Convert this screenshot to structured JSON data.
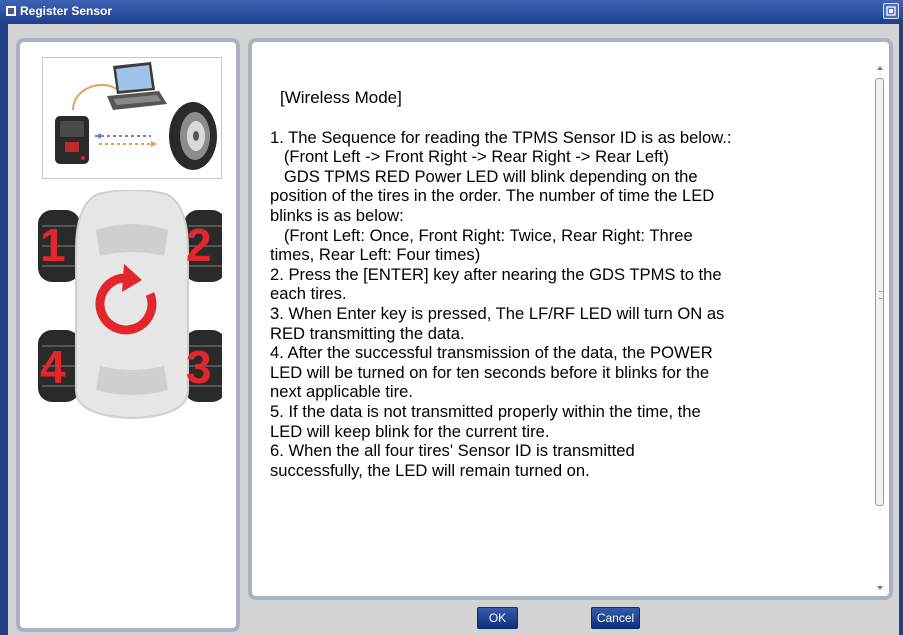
{
  "window": {
    "title": "Register Sensor"
  },
  "content": {
    "heading": "[Wireless Mode]",
    "lines": [
      "1. The Sequence for reading the TPMS Sensor ID is as below.:",
      "   (Front Left -> Front Right -> Rear Right -> Rear Left)",
      "   GDS TPMS RED Power LED will blink depending on the",
      "position of the tires in the order. The number of time the LED",
      "blinks is as below:",
      "   (Front Left: Once, Front Right: Twice, Rear Right: Three",
      "times, Rear Left: Four times)",
      "2. Press the [ENTER] key after nearing the GDS TPMS to the",
      "each tires.",
      "3. When Enter key is pressed, The LF/RF LED will turn ON as",
      "RED transmitting the data.",
      "4. After the successful transmission of the data, the POWER",
      "LED will be turned on for ten seconds before it blinks for the",
      "next applicable tire.",
      "5. If the data is not transmitted properly within the time, the",
      "LED will keep blink for the current tire.",
      "6. When the all four tires' Sensor ID is transmitted",
      "successfully, the LED will remain turned on."
    ]
  },
  "illustration": {
    "wheel_numbers": {
      "front_left": "1",
      "front_right": "2",
      "rear_left": "4",
      "rear_right": "3"
    }
  },
  "buttons": {
    "ok": "OK",
    "cancel": "Cancel"
  },
  "colors": {
    "title_bar": "#2a4c9c",
    "frame": "#1f3f86",
    "accent_red": "#e2262c",
    "button": "#1f4592"
  },
  "icons": [
    "window-icon",
    "restore-icon",
    "scroll-up-icon",
    "scroll-down-icon",
    "laptop-icon",
    "scanner-device-icon",
    "tire-icon",
    "car-top-view-icon",
    "rotation-arrow-icon"
  ]
}
